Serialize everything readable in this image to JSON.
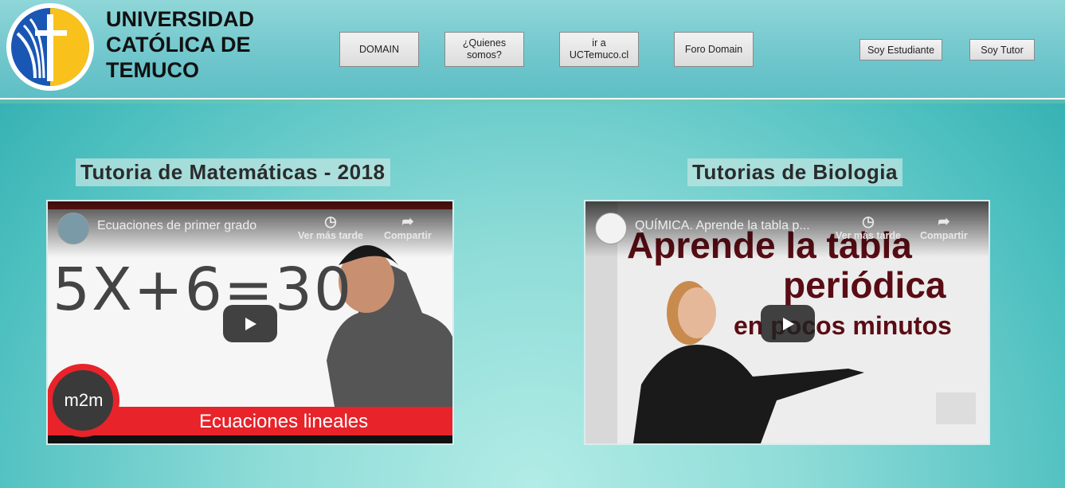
{
  "header": {
    "university_name": "UNIVERSIDAD\nCATÓLICA DE\nTEMUCO",
    "nav": [
      {
        "label": "DOMAIN"
      },
      {
        "label": "¿Quienes\nsomos?"
      },
      {
        "label": "ir a\nUCTemuco.cl"
      },
      {
        "label": "Foro Domain"
      }
    ],
    "student_button": "Soy Estudiante",
    "tutor_button": "Soy Tutor"
  },
  "sections": [
    {
      "title": "Tutoria de Matemáticas - 2018",
      "video": {
        "title": "Ecuaciones de primer grado",
        "watch_later": "Ver más tarde",
        "share": "Compartir",
        "thumb_equation": "5X+6=30",
        "thumb_brand": "m2m",
        "thumb_caption": "Ecuaciones lineales"
      }
    },
    {
      "title": "Tutorias de Biologia",
      "video": {
        "title": "QUÍMICA. Aprende la tabla p...",
        "watch_later": "Ver más tarde",
        "share": "Compartir",
        "thumb_line1": "Aprende la tabla",
        "thumb_line2": "periódica",
        "thumb_line3": "en pocos minutos"
      }
    }
  ],
  "colors": {
    "accent_red": "#e8232a",
    "logo_blue": "#1a57b4",
    "logo_yellow": "#f9c11b",
    "thumb_text_maroon": "#5a0c14"
  }
}
